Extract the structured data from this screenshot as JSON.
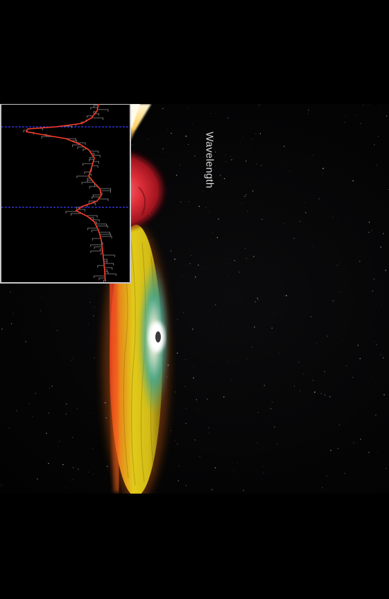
{
  "image": {
    "subject": "artist-impression",
    "background_color": "#000000",
    "colors": {
      "star_red": "#e0303a",
      "disk_yellow": "#e8d21a",
      "disk_orange": "#f08a1c",
      "jet_white": "#fff6d8",
      "core_teal": "#3aa89a",
      "spectrum_line": "#ff3b2a",
      "marker_blue": "#3c3cff",
      "frame_gray": "#c8c8c8"
    }
  },
  "inset_plot": {
    "axis_label": "Wavelength",
    "marker_lines": 2
  }
}
